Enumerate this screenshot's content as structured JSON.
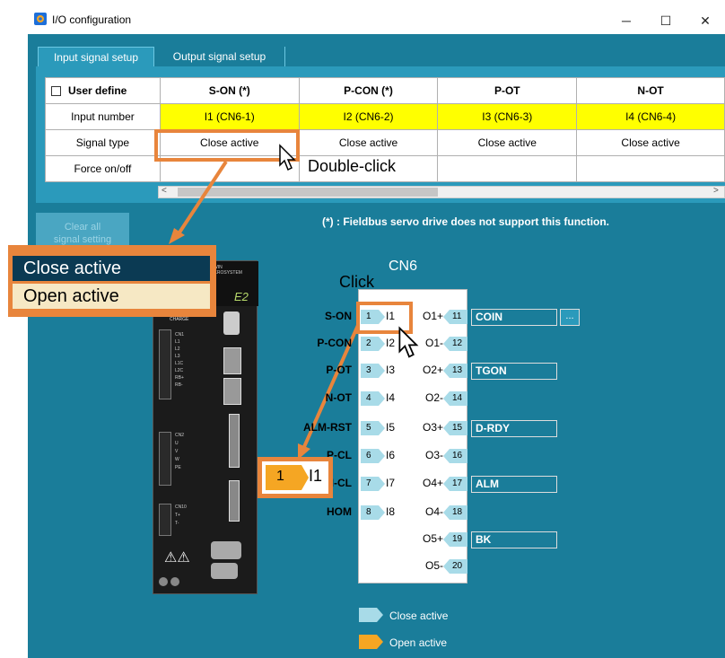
{
  "window": {
    "title": "I/O configuration",
    "minimize": "─",
    "maximize": "☐",
    "close": "✕"
  },
  "tabs": [
    {
      "label": "Input signal setup"
    },
    {
      "label": "Output signal setup"
    }
  ],
  "table": {
    "user_define_label": "User define",
    "columns": [
      "S-ON (*)",
      "P-CON (*)",
      "P-OT",
      "N-OT"
    ],
    "rows": {
      "input_number": {
        "label": "Input number",
        "values": [
          "I1 (CN6-1)",
          "I2 (CN6-2)",
          "I3 (CN6-3)",
          "I4 (CN6-4)"
        ]
      },
      "signal_type": {
        "label": "Signal type",
        "values": [
          "Close active",
          "Close active",
          "Close active",
          "Close active"
        ]
      },
      "force": {
        "label": "Force on/off",
        "values": [
          "",
          "",
          "",
          ""
        ]
      }
    }
  },
  "annotations": {
    "double_click": "Double-click",
    "click": "Click"
  },
  "clear_button": {
    "line1": "Clear all",
    "line2": "signal setting"
  },
  "note": "(*) : Fieldbus servo drive does not support this function.",
  "dropdown": {
    "options": [
      "Close active",
      "Open active"
    ],
    "selected": "Close active"
  },
  "drive": {
    "brand": "HIWIN MIKROSYSTEM",
    "model": "E2",
    "charge": "CHARGE",
    "labels": [
      "CN1",
      "L1",
      "L2",
      "L3",
      "L1C",
      "L2C",
      "RB+",
      "RB-",
      "CN2",
      "U",
      "V",
      "W",
      "PE",
      "CN10",
      "T+",
      "T-"
    ]
  },
  "cn6": {
    "title": "CN6",
    "inputs": [
      {
        "signal": "S-ON",
        "pin": "1",
        "name": "I1"
      },
      {
        "signal": "P-CON",
        "pin": "2",
        "name": "I2"
      },
      {
        "signal": "P-OT",
        "pin": "3",
        "name": "I3"
      },
      {
        "signal": "N-OT",
        "pin": "4",
        "name": "I4"
      },
      {
        "signal": "ALM-RST",
        "pin": "5",
        "name": "I5"
      },
      {
        "signal": "P-CL",
        "pin": "6",
        "name": "I6"
      },
      {
        "signal": "N-CL",
        "pin": "7",
        "name": "I7"
      },
      {
        "signal": "HOM",
        "pin": "8",
        "name": "I8"
      }
    ],
    "outputs": [
      {
        "name": "O1+",
        "pin": "11",
        "signal": "COIN"
      },
      {
        "name": "O1-",
        "pin": "12",
        "signal": ""
      },
      {
        "name": "O2+",
        "pin": "13",
        "signal": "TGON"
      },
      {
        "name": "O2-",
        "pin": "14",
        "signal": ""
      },
      {
        "name": "O3+",
        "pin": "15",
        "signal": "D-RDY"
      },
      {
        "name": "O3-",
        "pin": "16",
        "signal": ""
      },
      {
        "name": "O4+",
        "pin": "17",
        "signal": "ALM"
      },
      {
        "name": "O4-",
        "pin": "18",
        "signal": ""
      },
      {
        "name": "O5+",
        "pin": "19",
        "signal": "BK"
      },
      {
        "name": "O5-",
        "pin": "20",
        "signal": ""
      }
    ],
    "more_button": "..."
  },
  "zoom_pin": {
    "pin": "1",
    "name": "I1"
  },
  "legend": [
    {
      "label": "Close active",
      "color": "#a8dbe8"
    },
    {
      "label": "Open active",
      "color": "#f5a623"
    }
  ],
  "colors": {
    "accent": "#1a7d9a",
    "highlight": "#e8853c",
    "yellow": "#ffff00"
  }
}
